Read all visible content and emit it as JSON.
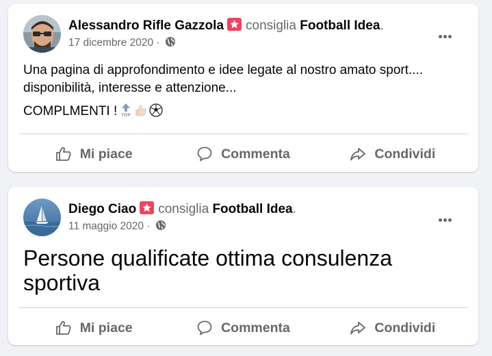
{
  "posts": [
    {
      "author": "Alessandro Rifle Gazzola",
      "verb": "consiglia",
      "page": "Football Idea",
      "date": "17 dicembre 2020",
      "separator": "·",
      "text_line1": "Una pagina di approfondimento e idee legate al nostro amato sport.... disponibilità, interesse e attenzione...",
      "text_line2": "COMPLMENTI !",
      "emojis": [
        "top-arrow-emoji",
        "thumbs-up-emoji",
        "soccer-ball-emoji"
      ],
      "like_label": "Mi piace",
      "comment_label": "Commenta",
      "share_label": "Condividi"
    },
    {
      "author": "Diego Ciao",
      "verb": "consiglia",
      "page": "Football Idea",
      "date": "11 maggio 2020",
      "separator": "·",
      "text": "Persone qualificate ottima consulenza sportiva",
      "like_label": "Mi piace",
      "comment_label": "Commenta",
      "share_label": "Condividi"
    }
  ],
  "icons": {
    "recommend_badge": "recommend-star-icon",
    "privacy": "globe-icon",
    "more": "more-options-icon",
    "like": "thumbs-up-icon",
    "comment": "comment-bubble-icon",
    "share": "share-arrow-icon"
  },
  "colors": {
    "background": "#f0f2f5",
    "card": "#ffffff",
    "badge": "#f3425f",
    "secondary_text": "#65676b",
    "divider": "#ced0d4"
  }
}
